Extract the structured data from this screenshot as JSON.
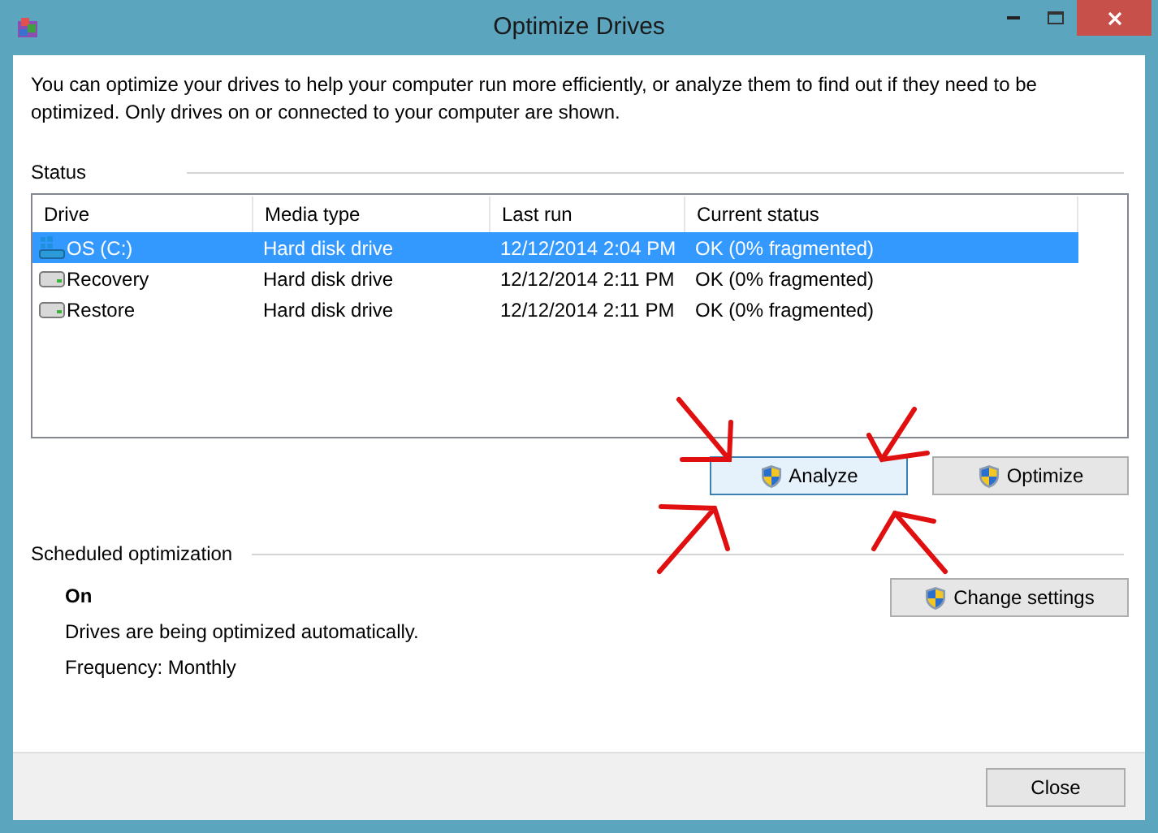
{
  "window": {
    "title": "Optimize Drives"
  },
  "description": "You can optimize your drives to help your computer run more efficiently, or analyze them to find out if they need to be optimized. Only drives on or connected to your computer are shown.",
  "status": {
    "label": "Status",
    "table": {
      "columns": [
        "Drive",
        "Media type",
        "Last run",
        "Current status"
      ],
      "rows": [
        {
          "kind": "system",
          "drive": "OS (C:)",
          "media_type": "Hard disk drive",
          "last_run": "12/12/2014 2:04 PM",
          "current_status": "OK (0% fragmented)",
          "selected": true
        },
        {
          "kind": "disk",
          "drive": "Recovery",
          "media_type": "Hard disk drive",
          "last_run": "12/12/2014 2:11 PM",
          "current_status": "OK (0% fragmented)",
          "selected": false
        },
        {
          "kind": "disk",
          "drive": "Restore",
          "media_type": "Hard disk drive",
          "last_run": "12/12/2014 2:11 PM",
          "current_status": "OK (0% fragmented)",
          "selected": false
        }
      ]
    },
    "buttons": [
      {
        "label": "Analyze",
        "focused": true
      },
      {
        "label": "Optimize",
        "focused": false
      }
    ]
  },
  "scheduled": {
    "label": "Scheduled optimization",
    "state": "On",
    "detail": "Drives are being optimized automatically.",
    "frequency": "Frequency: Monthly",
    "button": "Change settings"
  },
  "close_button": "Close"
}
